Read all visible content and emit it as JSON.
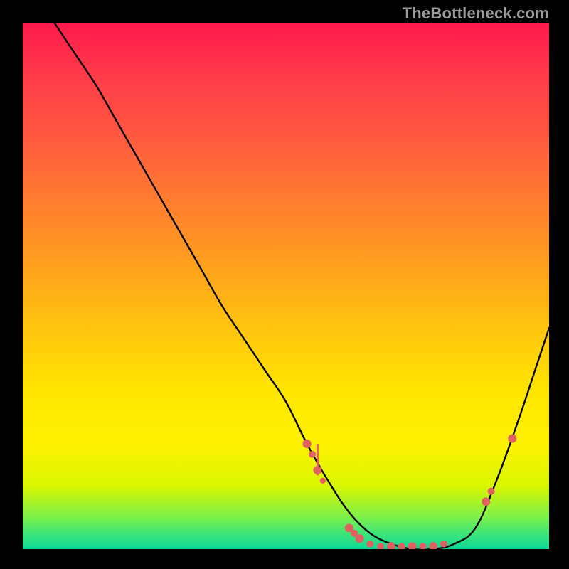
{
  "watermark": "TheBottleneck.com",
  "colors": {
    "background": "#000000",
    "gradient_top": "#ff1a4d",
    "gradient_bottom": "#0fd69b",
    "curve": "#000000",
    "marker": "#e06060"
  },
  "chart_data": {
    "type": "line",
    "title": "",
    "xlabel": "",
    "ylabel": "",
    "xlim": [
      0,
      100
    ],
    "ylim": [
      0,
      100
    ],
    "series": [
      {
        "name": "curve",
        "x": [
          6,
          10,
          14,
          18,
          22,
          26,
          30,
          34,
          38,
          42,
          46,
          50,
          54,
          58,
          62,
          66,
          70,
          74,
          78,
          82,
          86,
          90,
          94,
          98,
          100
        ],
        "values": [
          100,
          94,
          88,
          81,
          74,
          67,
          60,
          53,
          46,
          40,
          34,
          28,
          20,
          13,
          7,
          3,
          1,
          0,
          0,
          1,
          4,
          13,
          24,
          36,
          42
        ]
      }
    ],
    "markers": [
      {
        "x": 54,
        "y": 20,
        "r": 6
      },
      {
        "x": 55,
        "y": 18,
        "r": 5
      },
      {
        "x": 56,
        "y": 15,
        "r": 6
      },
      {
        "x": 57,
        "y": 13,
        "r": 4
      },
      {
        "x": 62,
        "y": 4,
        "r": 6
      },
      {
        "x": 63,
        "y": 3,
        "r": 5
      },
      {
        "x": 64,
        "y": 2,
        "r": 6
      },
      {
        "x": 66,
        "y": 1,
        "r": 5
      },
      {
        "x": 68,
        "y": 0.5,
        "r": 5
      },
      {
        "x": 70,
        "y": 0.5,
        "r": 6
      },
      {
        "x": 72,
        "y": 0.5,
        "r": 5
      },
      {
        "x": 74,
        "y": 0.5,
        "r": 6
      },
      {
        "x": 76,
        "y": 0.5,
        "r": 5
      },
      {
        "x": 78,
        "y": 0.5,
        "r": 6
      },
      {
        "x": 80,
        "y": 1,
        "r": 5
      },
      {
        "x": 88,
        "y": 9,
        "r": 6
      },
      {
        "x": 89,
        "y": 11,
        "r": 5
      },
      {
        "x": 93,
        "y": 21,
        "r": 6
      }
    ],
    "marker_tick": {
      "x": 56,
      "y_from": 14,
      "y_to": 20
    }
  }
}
